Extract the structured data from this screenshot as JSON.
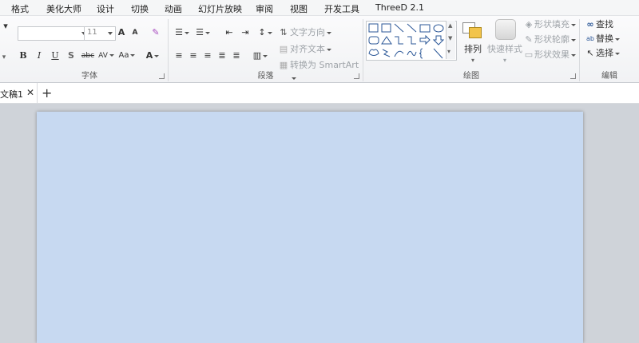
{
  "menu": [
    "格式",
    "美化大师",
    "设计",
    "切换",
    "动画",
    "幻灯片放映",
    "审阅",
    "视图",
    "开发工具",
    "ThreeD 2.1"
  ],
  "font_group": {
    "label": "字体",
    "font_name": "",
    "font_size": "11",
    "grow_label": "A",
    "shrink_label": "A",
    "bold": "B",
    "italic": "I",
    "underline": "U",
    "shadow": "S",
    "strike": "abc",
    "spacing": "AV",
    "case": "Aa",
    "color": "A"
  },
  "paragraph_group": {
    "label": "段落",
    "text_direction": "文字方向",
    "align_text": "对齐文本",
    "convert_smartart": "转换为 SmartArt"
  },
  "drawing_group": {
    "label": "绘图",
    "arrange": "排列",
    "quick_styles": "快速样式",
    "shape_fill": "形状填充",
    "shape_outline": "形状轮廓",
    "shape_effects": "形状效果"
  },
  "editing_group": {
    "label": "编辑",
    "find": "查找",
    "replace": "替换",
    "select": "选择"
  },
  "document": {
    "tab_name": "文稿1",
    "close_glyph": "✕",
    "new_tab_glyph": "+"
  },
  "colors": {
    "slide_fill": "#c7d9f1",
    "accent": "#2b5797"
  }
}
